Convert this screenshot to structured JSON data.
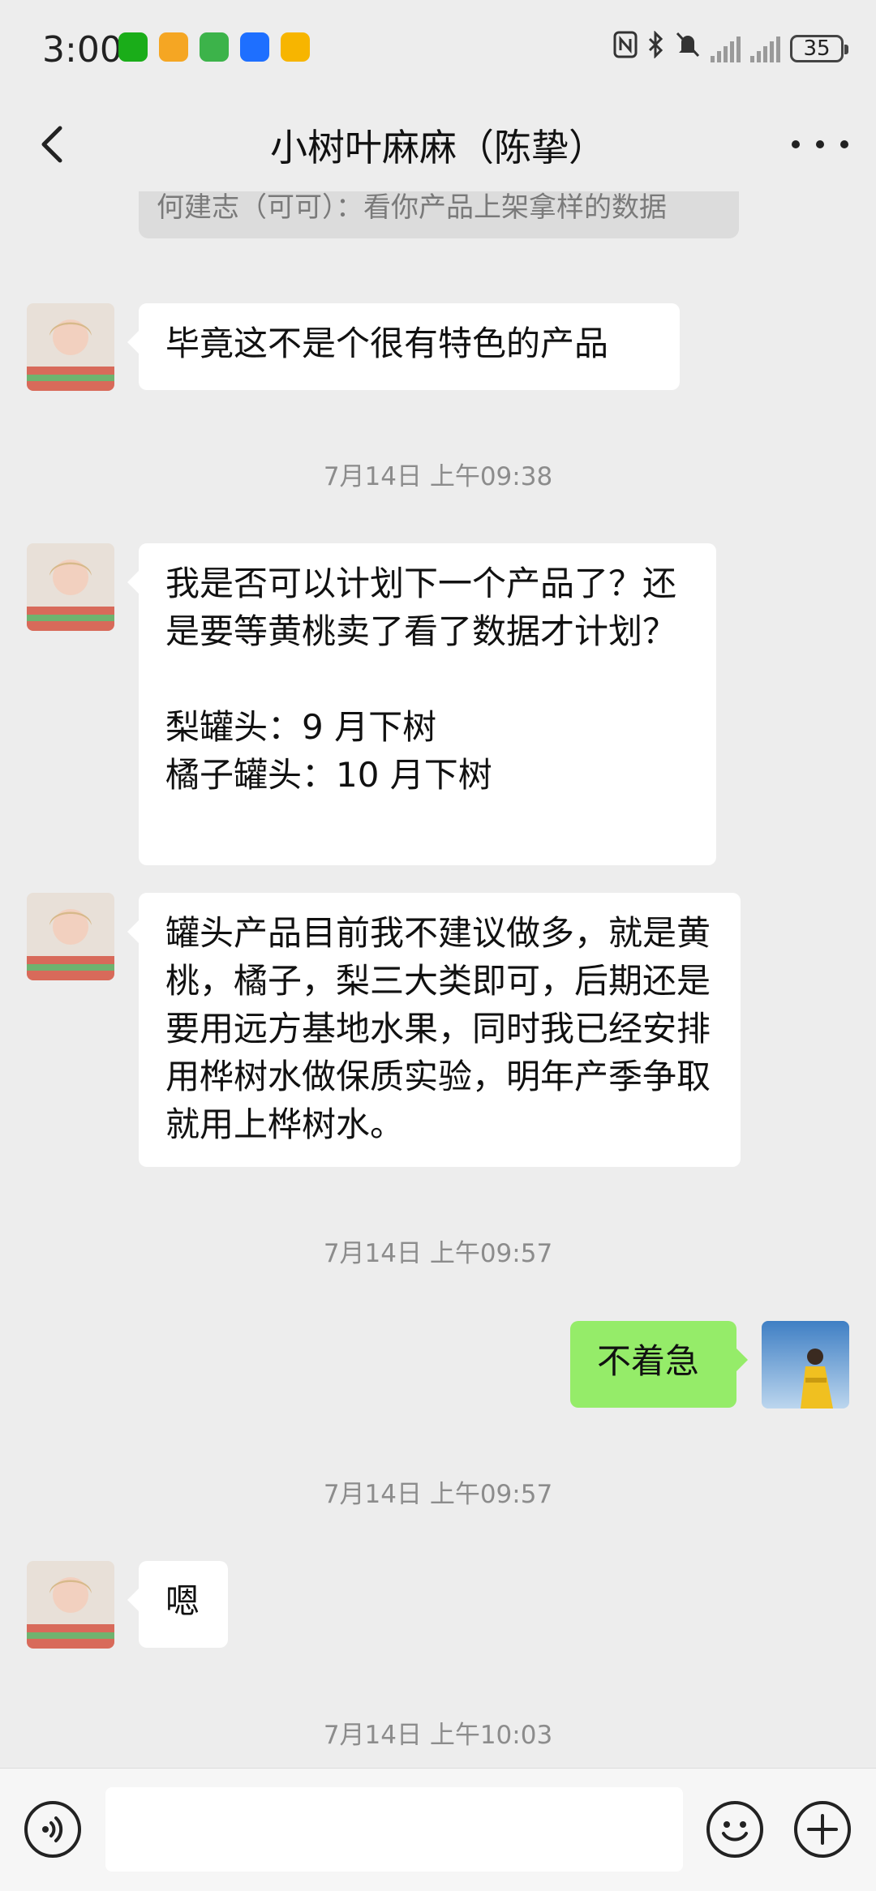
{
  "status_bar": {
    "time": "3:00",
    "battery": "35",
    "app_icon_colors": [
      "#1aad19",
      "#f5a623",
      "#3cb34a",
      "#1e6fff",
      "#f7b500"
    ]
  },
  "header": {
    "title": "小树叶麻麻（陈挚）"
  },
  "chat": {
    "quoted_text": "何建志（可可）：看你产品上架拿样的数据",
    "messages": [
      {
        "text": "毕竟这不是个很有特色的产品"
      },
      {
        "timestamp": "7月14日 上午09:38"
      },
      {
        "text": "我是否可以计划下一个产品了？还是要等黄桃卖了看了数据才计划？\n\n梨罐头：9 月下树\n橘子罐头：10 月下树"
      },
      {
        "text": "罐头产品目前我不建议做多，就是黄桃，橘子，梨三大类即可，后期还是要用远方基地水果，同时我已经安排用桦树水做保质实验，明年产季争取就用上桦树水。"
      },
      {
        "timestamp": "7月14日 上午09:57"
      },
      {
        "text": "不着急"
      },
      {
        "timestamp": "7月14日 上午09:57"
      },
      {
        "text": "嗯"
      },
      {
        "timestamp": "7月14日 上午10:03"
      }
    ]
  },
  "input_bar": {
    "value": "",
    "icons": [
      "voice-icon",
      "emoji-icon",
      "plus-icon"
    ]
  },
  "colors": {
    "background": "#ededed",
    "my_bubble": "#95ec69",
    "their_bubble": "#ffffff"
  }
}
